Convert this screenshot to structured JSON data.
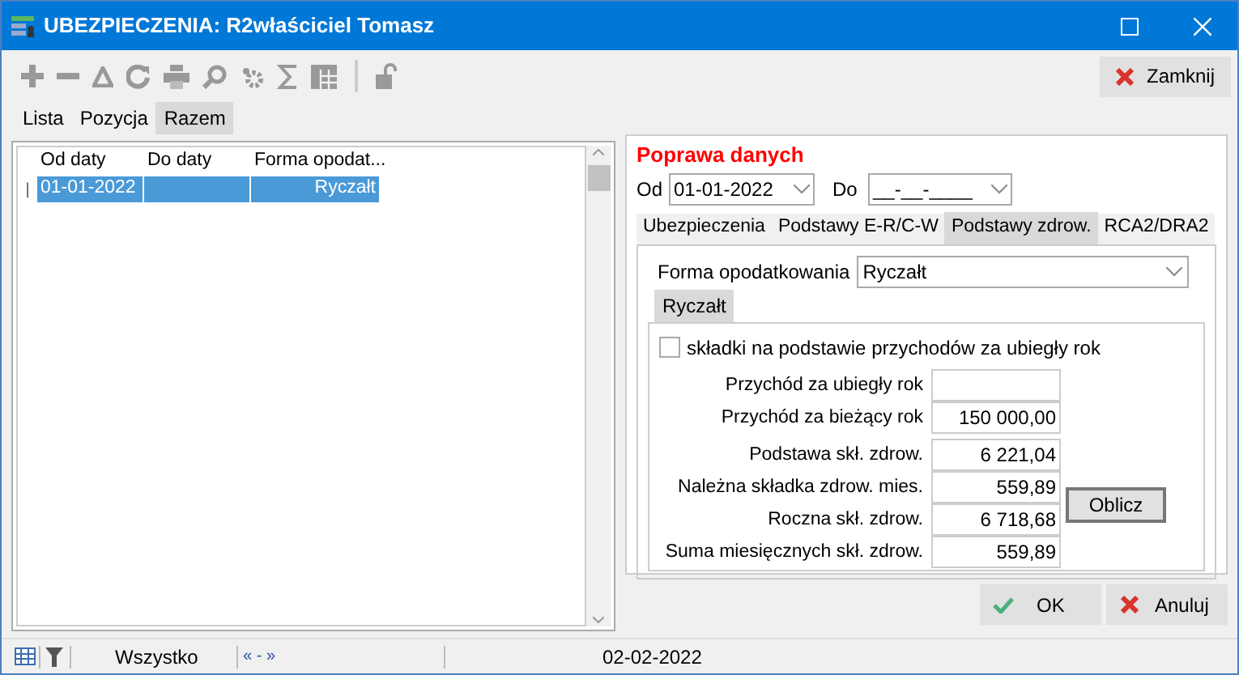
{
  "window": {
    "title": "UBEZPIECZENIA: R2właściciel Tomasz"
  },
  "toolbar": {
    "close_button": "Zamknij"
  },
  "tabs": [
    {
      "label": "Lista",
      "selected": false
    },
    {
      "label": "Pozycja",
      "selected": false
    },
    {
      "label": "Razem",
      "selected": true
    }
  ],
  "table": {
    "columns": [
      "Od daty",
      "Do daty",
      "Forma opodat..."
    ],
    "rows": [
      {
        "marker": "|",
        "cells": [
          "01-01-2022",
          "",
          "Ryczałt"
        ],
        "selected": true
      }
    ]
  },
  "form": {
    "title": "Poprawa danych",
    "from": {
      "label": "Od",
      "value": "01-01-2022"
    },
    "to": {
      "label": "Do",
      "value": "__-__-____"
    },
    "tabs": [
      {
        "label": "Ubezpieczenia",
        "selected": false
      },
      {
        "label": "Podstawy E-R/C-W",
        "selected": false
      },
      {
        "label": "Podstawy zdrow.",
        "selected": true
      },
      {
        "label": "RCA2/DRA2",
        "selected": false
      }
    ],
    "tax_form": {
      "label": "Forma opodatkowania",
      "value": "Ryczałt"
    },
    "subtabs": [
      {
        "label": "Ryczałt",
        "selected": true
      }
    ],
    "checkbox": {
      "label": "składki na podstawie przychodów za ubiegły rok",
      "checked": false
    },
    "income_fields": [
      {
        "label": "Przychód za ubiegły rok"
      },
      {
        "label": "Przychód za bieżący rok",
        "value": "150 000,00"
      }
    ],
    "contribution_fields": [
      {
        "label": "Podstawa skł. zdrow.",
        "value": "6 221,04"
      },
      {
        "label": "Należna składka zdrow. mies.",
        "value": "559,89"
      },
      {
        "label": "Roczna skł. zdrow.",
        "value": "6 718,68"
      },
      {
        "label": "Suma miesięcznych skł. zdrow.",
        "value": "559,89"
      }
    ],
    "calculate_button": "Oblicz"
  },
  "buttons": {
    "ok": "OK",
    "cancel": "Anuluj"
  },
  "status_bar": {
    "filter": "Wszystko",
    "navigation": "« - »",
    "date": "02-02-2022"
  }
}
